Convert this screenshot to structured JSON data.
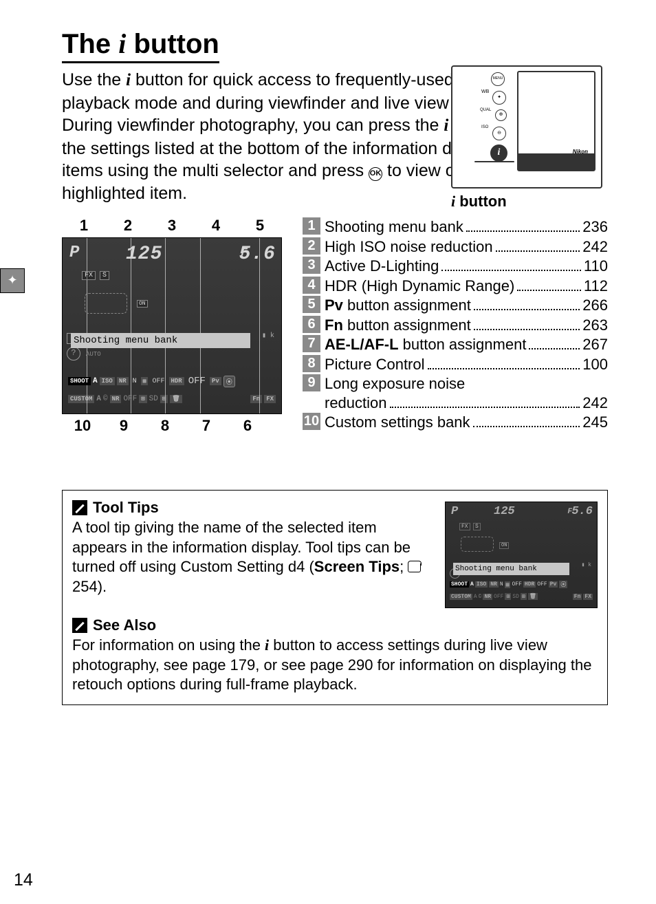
{
  "title_prefix": "The ",
  "title_i": "i",
  "title_suffix": " button",
  "intro_p1a": "Use the ",
  "intro_p1b": " button for quick access to frequently-used settings in playback mode and during viewfinder and live view photography. During viewfinder photography, you can press the ",
  "intro_p1c": " button to change the settings listed at the bottom of the information display.  Highlight items using the multi selector and press ",
  "intro_p1d": " to view options for the highlighted item.",
  "ok_glyph": "OK",
  "camera": {
    "menu": "MENU",
    "wb": "WB",
    "qual": "QUAL",
    "iso": "ISO",
    "brand": "Nikon",
    "caption_i": "i",
    "caption": " button"
  },
  "callouts_top": [
    "1",
    "2",
    "3",
    "4",
    "5"
  ],
  "callouts_bot": [
    "10",
    "9",
    "8",
    "7",
    "6"
  ],
  "lcd": {
    "mode": "P",
    "shutter": "125",
    "aperture_f": "F",
    "aperture": "5.6",
    "fx": "FX",
    "s": "S",
    "on": "ON",
    "tooltip": "Shooting menu bank",
    "auto": "AUTO",
    "shoot": "SHOOT",
    "bankA1": "A",
    "iso": "ISO",
    "nr": "NR",
    "n": "N",
    "adl_off": "OFF",
    "hdr": "HDR",
    "hdr_off": "OFF",
    "pv": "Pv",
    "fn_circ": "⦿",
    "custom": "CUSTOM",
    "bankA2": "A",
    "copyright": "©",
    "wb": "NR",
    "off2": "OFF",
    "sd": "SD",
    "pic": "⊞",
    "trash": "🗑",
    "fn": "Fn",
    "fx2": "FX"
  },
  "features": [
    {
      "n": "1",
      "label": "Shooting menu bank",
      "page": "236"
    },
    {
      "n": "2",
      "label": "High ISO noise reduction",
      "page": "242"
    },
    {
      "n": "3",
      "label": "Active D-Lighting",
      "page": "110"
    },
    {
      "n": "4",
      "label": "HDR (High Dynamic Range)",
      "page": "112"
    },
    {
      "n": "5",
      "label_pre": "",
      "label_bold": "Pv",
      "label_post": " button assignment",
      "page": "266"
    },
    {
      "n": "6",
      "label_pre": "",
      "label_bold": "Fn",
      "label_post": " button assignment",
      "page": "263"
    },
    {
      "n": "7",
      "label_pre": "",
      "label_bold": "AE-L/AF-L",
      "label_post": " button assignment",
      "page": "267"
    },
    {
      "n": "8",
      "label": "Picture Control",
      "page": "100"
    },
    {
      "n": "9",
      "label": "Long exposure noise",
      "sub": "reduction",
      "page": "242"
    },
    {
      "n": "10",
      "label": "Custom settings bank",
      "page": "245"
    }
  ],
  "tooltips_box": {
    "heading": "Tool Tips",
    "body_a": "A tool tip giving the name of the selected item appears in the information display.  Tool tips can be turned off using Custom Setting d4 (",
    "body_bold": "Screen Tips",
    "body_b": "; ",
    "body_page": " 254)."
  },
  "see_also": {
    "heading": "See Also",
    "body_a": "For information on using the ",
    "body_b": " button to access settings during live view photography, see page 179, or see page 290 for information on displaying the retouch options during full-frame playback."
  },
  "page_number": "14"
}
